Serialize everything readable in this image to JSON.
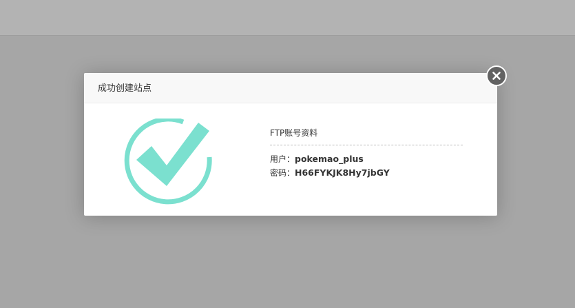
{
  "dialog": {
    "title": "成功创建站点",
    "close_icon": "close-icon",
    "success_icon": "check-circle-icon",
    "success_color": "#7be0cf",
    "ftp": {
      "heading": "FTP账号资料",
      "user_label": "用户：",
      "user_value": "pokemao_plus",
      "password_label": "密码：",
      "password_value": "H66FYKJK8Hy7jbGY"
    }
  }
}
